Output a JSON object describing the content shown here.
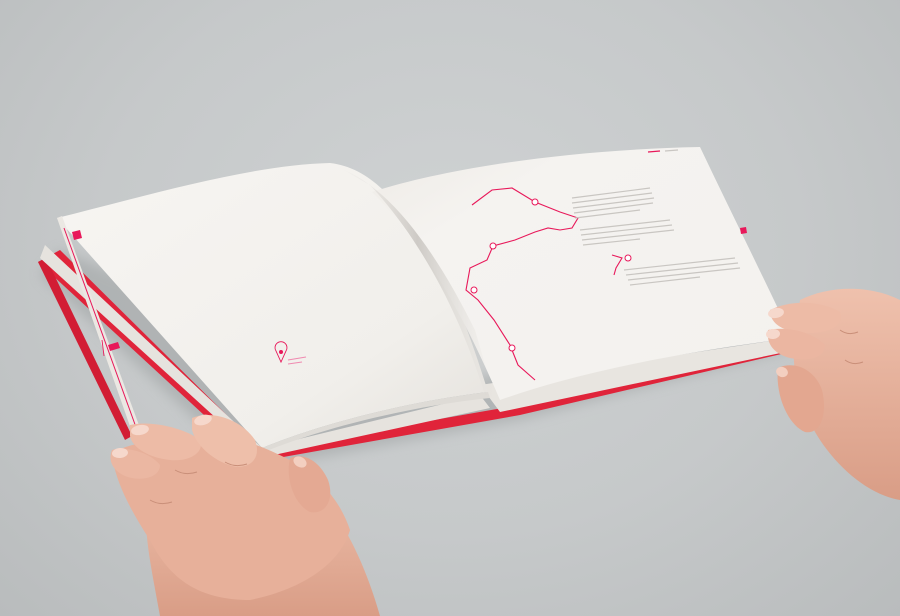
{
  "scene": {
    "description_free": true,
    "colors": {
      "background": "#c7cacb",
      "paper": "#f4f2ef",
      "accent": "#e8185a",
      "skin": "#e9b49e",
      "cover_edge": "#e0243a"
    }
  },
  "right_page": {
    "header_text": "",
    "paragraphs": [
      "",
      "",
      ""
    ]
  },
  "left_page": {
    "pin_label": ""
  }
}
